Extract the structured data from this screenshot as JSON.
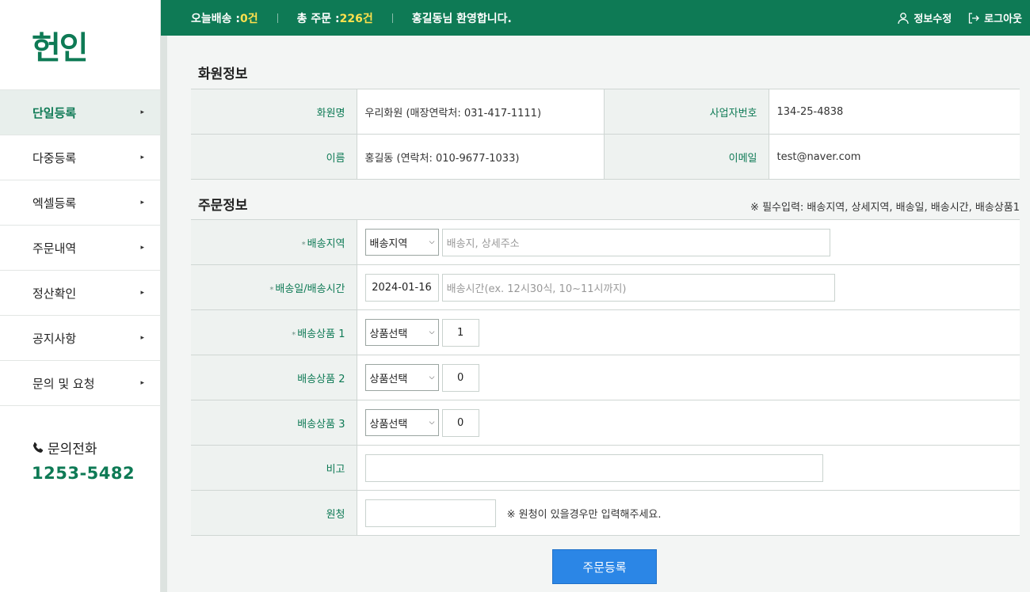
{
  "brand": {
    "logo": "헌인"
  },
  "sidebar": {
    "items": [
      {
        "label": "단일등록",
        "active": true
      },
      {
        "label": "다중등록"
      },
      {
        "label": "엑셀등록"
      },
      {
        "label": "주문내역"
      },
      {
        "label": "정산확인"
      },
      {
        "label": "공지사항"
      },
      {
        "label": "문의 및 요청"
      }
    ],
    "arrow": "▸",
    "contact_label": "문의전화",
    "contact_number": "1253-5482"
  },
  "topbar": {
    "today_label": "오늘배송 : ",
    "today_value": "0건",
    "total_label": "총 주문 : ",
    "total_value": "226건",
    "welcome": "홍길동님 환영합니다.",
    "edit_info": "정보수정",
    "logout": "로그아웃"
  },
  "member": {
    "title": "화원정보",
    "shop_label": "화원명",
    "shop_value": "우리화원 (매장연락처: 031-417-1111)",
    "biz_label": "사업자번호",
    "biz_value": "134-25-4838",
    "name_label": "이름",
    "name_value": "홍길동 (연락처: 010-9677-1033)",
    "email_label": "이메일",
    "email_value": "test@naver.com"
  },
  "order": {
    "title": "주문정보",
    "required_note": "※ 필수입력: 배송지역, 상세지역, 배송일, 배송시간, 배송상품1",
    "required_mark": "*",
    "region_label": "배송지역",
    "region_select": "배송지역",
    "address_placeholder": "배송지, 상세주소",
    "date_label": "배송일/배송시간",
    "date_value": "2024-01-16",
    "time_placeholder": "배송시간(ex. 12시30식, 10~11시까지)",
    "product1_label": "배송상품 1",
    "product2_label": "배송상품 2",
    "product3_label": "배송상품 3",
    "product_select": "상품선택",
    "qty1": "1",
    "qty2": "0",
    "qty3": "0",
    "memo_label": "비고",
    "sender_label": "원청",
    "sender_note": "※ 원청이 있을경우만 입력해주세요.",
    "submit": "주문등록"
  }
}
